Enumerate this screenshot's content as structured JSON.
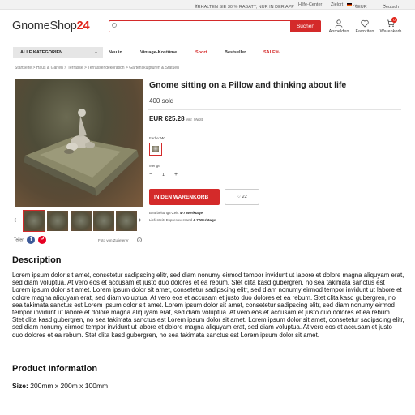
{
  "topbar": {
    "promo": "ERHALTEN SIE 30 % RABATT, NUR IN DER APP",
    "help": "Hilfe-Center",
    "country": "Zielort",
    "currency": "/ €EUR",
    "language": "Deutsch"
  },
  "header": {
    "logo_main": "GnomeShop",
    "logo_suffix": "24",
    "search_placeholder": "",
    "search_button": "Suchen",
    "account": "Anmelden",
    "favorites": "Favoriten",
    "cart": "Warenkorb",
    "cart_count": "0"
  },
  "nav": {
    "all_categories": "ALLE KATEGORIEN",
    "items": [
      "Neu in",
      "Vintage-Kostüme",
      "Sport",
      "Bestseller",
      "SALE%"
    ]
  },
  "breadcrumb": "Startseite > Haus & Garten > Terrasse > Terrassendekoration > Gartenskulpturen & Statuen",
  "product": {
    "title": "Gnome sitting on a Pillow and thinking about life",
    "sold": "400 sold",
    "price": "EUR €25.28",
    "price_note": "inkl. MwSt.",
    "color_label": "Farbe:",
    "color_value": "W",
    "quantity_label": "Menge",
    "quantity": "1",
    "add_to_cart": "IN DEN WARENKORB",
    "wishlist_count": "22",
    "processing_label": "Bearbeitungs-Zeit:",
    "processing_value": "4-7 Werktage",
    "delivery_label": "Lieferzeit: Expressversand",
    "delivery_value": "4-7 Werktage",
    "share_label": "Teilen",
    "supplier_photo": "Foto von Zulieferer"
  },
  "description": {
    "heading": "Description",
    "text": "Lorem ipsum dolor sit amet, consetetur sadipscing elitr, sed diam nonumy eirmod tempor invidunt ut labore et dolore magna aliquyam erat, sed diam voluptua. At vero eos et accusam et justo duo dolores et ea rebum. Stet clita kasd gubergren, no sea takimata sanctus est Lorem ipsum dolor sit amet. Lorem ipsum dolor sit amet, consetetur sadipscing elitr, sed diam nonumy eirmod tempor invidunt ut labore et dolore magna aliquyam erat, sed diam voluptua. At vero eos et accusam et justo duo dolores et ea rebum. Stet clita kasd gubergren, no sea takimata sanctus est Lorem ipsum dolor sit amet. Lorem ipsum dolor sit amet, consetetur sadipscing elitr, sed diam nonumy eirmod tempor invidunt ut labore et dolore magna aliquyam erat, sed diam voluptua. At vero eos et accusam et justo duo dolores et ea rebum. Stet clita kasd gubergren, no sea takimata sanctus est Lorem ipsum dolor sit amet. Lorem ipsum dolor sit amet, consetetur sadipscing elitr, sed diam nonumy eirmod tempor invidunt ut labore et dolore magna aliquyam erat, sed diam voluptua. At vero eos et accusam et justo duo dolores et ea rebum. Stet clita kasd gubergren, no sea takimata sanctus est Lorem ipsum dolor sit amet."
  },
  "info": {
    "heading": "Product Information",
    "size_label": "Size:",
    "size_value": "200mm x 200m x 100mm"
  },
  "icons": {
    "account": "user-icon",
    "favorites": "heart-icon",
    "cart": "cart-icon",
    "search": "search-icon"
  },
  "colors": {
    "accent": "#d42a2a",
    "logo_accent": "#e1261c"
  }
}
